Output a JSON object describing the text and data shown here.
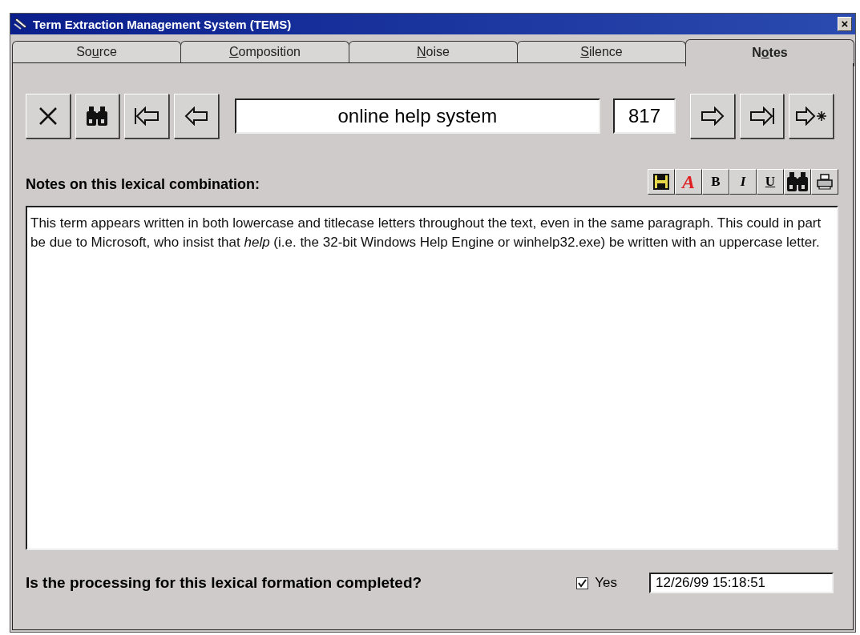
{
  "window": {
    "title": "Term Extraction Management System (TEMS)",
    "close": "×"
  },
  "tabs": [
    {
      "label_start": "So",
      "access_key": "u",
      "label_end": "rce",
      "selected": false
    },
    {
      "access_key": "C",
      "label_end": "omposition",
      "selected": false
    },
    {
      "access_key": "N",
      "label_end": "oise",
      "selected": false
    },
    {
      "access_key": "S",
      "label_end": "ilence",
      "selected": false
    },
    {
      "label_start": "N",
      "access_key": "o",
      "label_end": "tes",
      "selected": true
    }
  ],
  "navigation": {
    "left_buttons": [
      {
        "kind": "delete"
      },
      {
        "kind": "find"
      },
      {
        "kind": "first"
      },
      {
        "kind": "previous"
      }
    ],
    "term": "online help system",
    "record_number": "817",
    "right_buttons": [
      {
        "kind": "next"
      },
      {
        "kind": "last"
      },
      {
        "kind": "new"
      }
    ]
  },
  "notes": {
    "label": "Notes on this lexical combination:",
    "format_buttons": [
      {
        "kind": "save"
      },
      {
        "kind": "font",
        "text": "A"
      },
      {
        "kind": "bold",
        "text": "B"
      },
      {
        "kind": "italic",
        "text": "I"
      },
      {
        "kind": "underline",
        "text": "U"
      },
      {
        "kind": "find"
      },
      {
        "kind": "print"
      }
    ],
    "text": "This term appears written in both lowercase and titlecase letters throughout the text, even in the same paragraph.  This could in part be due to Microsoft, who insist that *help* (i.e. the 32-bit Windows Help Engine or winhelp32.exe) be written with an uppercase letter."
  },
  "completion": {
    "question": "Is the processing for this lexical formation completed?",
    "checkbox_label": "Yes",
    "checked": true,
    "timestamp": "12/26/99 15:18:51"
  }
}
